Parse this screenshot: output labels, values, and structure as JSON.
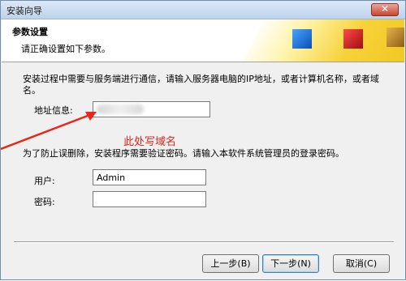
{
  "window": {
    "title": "安装向导",
    "close_glyph": "✕"
  },
  "header": {
    "title": "参数设置",
    "subtitle": "请正确设置如下参数。"
  },
  "description": "安装过程中需要与服务端进行通信，请输入服务器电脑的IP地址，或者计算机名称，或者域名。",
  "address": {
    "label": "地址信息:",
    "value": ""
  },
  "annotation": "此处写域名",
  "auth_note": "为了防止误删除，安装程序需要验证密码。请输入本软件系统管理员的登录密码。",
  "user": {
    "label": "用户:",
    "value": "Admin"
  },
  "password": {
    "label": "密码:",
    "value": ""
  },
  "buttons": {
    "back": "上一步(B)",
    "next": "下一步(N)",
    "cancel": "取消(C)"
  },
  "colors": {
    "annotation": "#e8261a",
    "accent_blue": "#0a4fb5",
    "accent_red": "#a10d0d",
    "accent_gold": "#f0c419"
  }
}
